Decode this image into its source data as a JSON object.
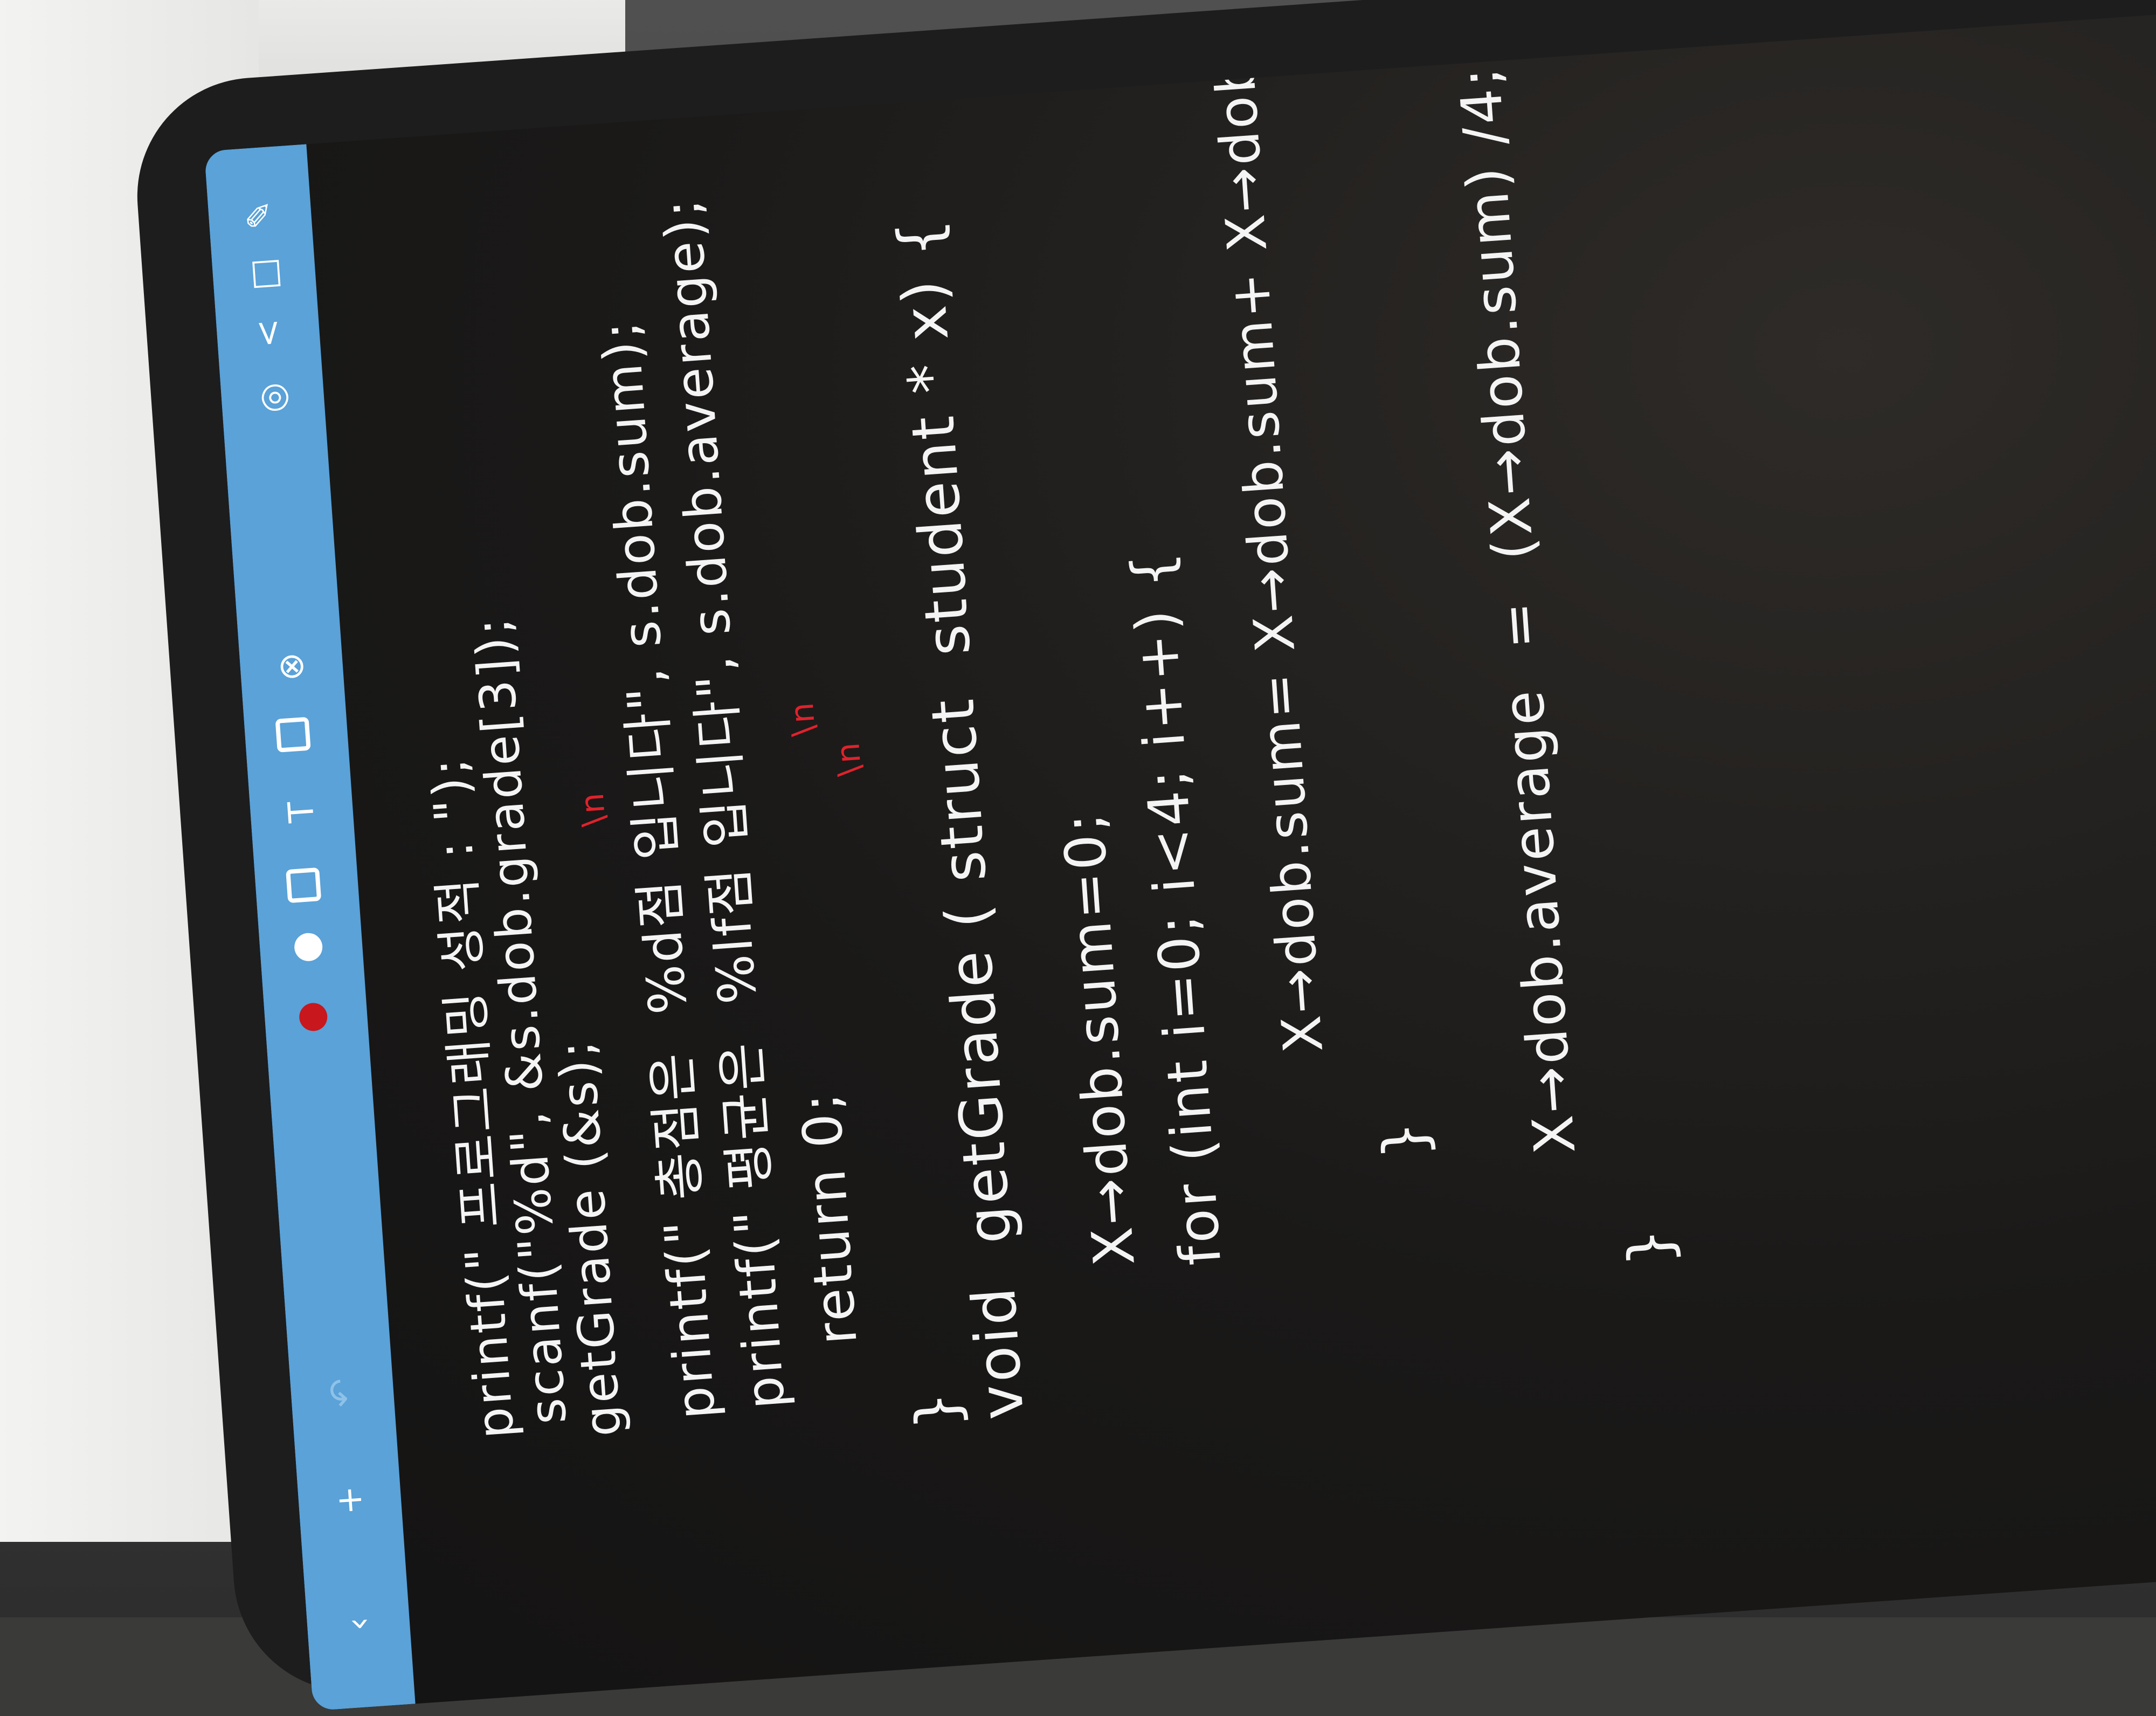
{
  "toolbar": {
    "icons": [
      "back-chevron-icon",
      "add-page-icon",
      "undo-icon",
      "redo-icon",
      "bookmark-icon",
      "pen-icon",
      "eraser-icon",
      "text-icon",
      "shape-icon",
      "lasso-icon",
      "image-icon",
      "pointer-icon",
      "share-icon",
      "settings-icon"
    ],
    "accent": "#5aa2d8",
    "bookmark_color": "#c8171d"
  },
  "note": {
    "ink_color": "#f4f4f4",
    "correction_color": "#e0222c",
    "lines": [
      "printf(\" 프로그래밍 성적 : \");",
      "scanf(\"%d\", &s.dob.grade[3]);",
      "getGrade (&s);",
      "printf(\" 총점은  %d점 입니다\", s.dob.sum);",
      "printf(\" 평균은  %lf점 입니다\", s.dob.average);",
      "return 0;",
      "}",
      "void  getGrade ( struct  student * x) {",
      "X→dob.sum=0;",
      "for (int i=0; i<4; i++) {",
      "X→dob.sum= X→dob.sum+ X→dob.grade[i",
      "}",
      "X→dob.average  =  (X→dob.sum) /4;",
      "}"
    ],
    "corrections": [
      "\\n",
      "\\n",
      "\\n"
    ]
  }
}
